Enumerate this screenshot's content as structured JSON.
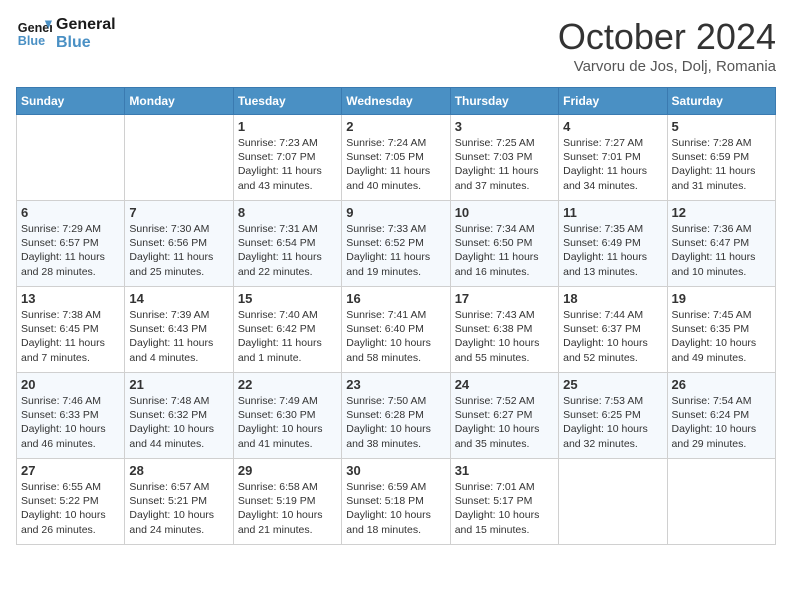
{
  "header": {
    "logo_line1": "General",
    "logo_line2": "Blue",
    "month_title": "October 2024",
    "location": "Varvoru de Jos, Dolj, Romania"
  },
  "days_of_week": [
    "Sunday",
    "Monday",
    "Tuesday",
    "Wednesday",
    "Thursday",
    "Friday",
    "Saturday"
  ],
  "weeks": [
    [
      {
        "day": null
      },
      {
        "day": null
      },
      {
        "day": "1",
        "sunrise": "7:23 AM",
        "sunset": "7:07 PM",
        "daylight": "11 hours and 43 minutes."
      },
      {
        "day": "2",
        "sunrise": "7:24 AM",
        "sunset": "7:05 PM",
        "daylight": "11 hours and 40 minutes."
      },
      {
        "day": "3",
        "sunrise": "7:25 AM",
        "sunset": "7:03 PM",
        "daylight": "11 hours and 37 minutes."
      },
      {
        "day": "4",
        "sunrise": "7:27 AM",
        "sunset": "7:01 PM",
        "daylight": "11 hours and 34 minutes."
      },
      {
        "day": "5",
        "sunrise": "7:28 AM",
        "sunset": "6:59 PM",
        "daylight": "11 hours and 31 minutes."
      }
    ],
    [
      {
        "day": "6",
        "sunrise": "7:29 AM",
        "sunset": "6:57 PM",
        "daylight": "11 hours and 28 minutes."
      },
      {
        "day": "7",
        "sunrise": "7:30 AM",
        "sunset": "6:56 PM",
        "daylight": "11 hours and 25 minutes."
      },
      {
        "day": "8",
        "sunrise": "7:31 AM",
        "sunset": "6:54 PM",
        "daylight": "11 hours and 22 minutes."
      },
      {
        "day": "9",
        "sunrise": "7:33 AM",
        "sunset": "6:52 PM",
        "daylight": "11 hours and 19 minutes."
      },
      {
        "day": "10",
        "sunrise": "7:34 AM",
        "sunset": "6:50 PM",
        "daylight": "11 hours and 16 minutes."
      },
      {
        "day": "11",
        "sunrise": "7:35 AM",
        "sunset": "6:49 PM",
        "daylight": "11 hours and 13 minutes."
      },
      {
        "day": "12",
        "sunrise": "7:36 AM",
        "sunset": "6:47 PM",
        "daylight": "11 hours and 10 minutes."
      }
    ],
    [
      {
        "day": "13",
        "sunrise": "7:38 AM",
        "sunset": "6:45 PM",
        "daylight": "11 hours and 7 minutes."
      },
      {
        "day": "14",
        "sunrise": "7:39 AM",
        "sunset": "6:43 PM",
        "daylight": "11 hours and 4 minutes."
      },
      {
        "day": "15",
        "sunrise": "7:40 AM",
        "sunset": "6:42 PM",
        "daylight": "11 hours and 1 minute."
      },
      {
        "day": "16",
        "sunrise": "7:41 AM",
        "sunset": "6:40 PM",
        "daylight": "10 hours and 58 minutes."
      },
      {
        "day": "17",
        "sunrise": "7:43 AM",
        "sunset": "6:38 PM",
        "daylight": "10 hours and 55 minutes."
      },
      {
        "day": "18",
        "sunrise": "7:44 AM",
        "sunset": "6:37 PM",
        "daylight": "10 hours and 52 minutes."
      },
      {
        "day": "19",
        "sunrise": "7:45 AM",
        "sunset": "6:35 PM",
        "daylight": "10 hours and 49 minutes."
      }
    ],
    [
      {
        "day": "20",
        "sunrise": "7:46 AM",
        "sunset": "6:33 PM",
        "daylight": "10 hours and 46 minutes."
      },
      {
        "day": "21",
        "sunrise": "7:48 AM",
        "sunset": "6:32 PM",
        "daylight": "10 hours and 44 minutes."
      },
      {
        "day": "22",
        "sunrise": "7:49 AM",
        "sunset": "6:30 PM",
        "daylight": "10 hours and 41 minutes."
      },
      {
        "day": "23",
        "sunrise": "7:50 AM",
        "sunset": "6:28 PM",
        "daylight": "10 hours and 38 minutes."
      },
      {
        "day": "24",
        "sunrise": "7:52 AM",
        "sunset": "6:27 PM",
        "daylight": "10 hours and 35 minutes."
      },
      {
        "day": "25",
        "sunrise": "7:53 AM",
        "sunset": "6:25 PM",
        "daylight": "10 hours and 32 minutes."
      },
      {
        "day": "26",
        "sunrise": "7:54 AM",
        "sunset": "6:24 PM",
        "daylight": "10 hours and 29 minutes."
      }
    ],
    [
      {
        "day": "27",
        "sunrise": "6:55 AM",
        "sunset": "5:22 PM",
        "daylight": "10 hours and 26 minutes."
      },
      {
        "day": "28",
        "sunrise": "6:57 AM",
        "sunset": "5:21 PM",
        "daylight": "10 hours and 24 minutes."
      },
      {
        "day": "29",
        "sunrise": "6:58 AM",
        "sunset": "5:19 PM",
        "daylight": "10 hours and 21 minutes."
      },
      {
        "day": "30",
        "sunrise": "6:59 AM",
        "sunset": "5:18 PM",
        "daylight": "10 hours and 18 minutes."
      },
      {
        "day": "31",
        "sunrise": "7:01 AM",
        "sunset": "5:17 PM",
        "daylight": "10 hours and 15 minutes."
      },
      {
        "day": null
      },
      {
        "day": null
      }
    ]
  ],
  "labels": {
    "sunrise": "Sunrise:",
    "sunset": "Sunset:",
    "daylight": "Daylight:"
  }
}
